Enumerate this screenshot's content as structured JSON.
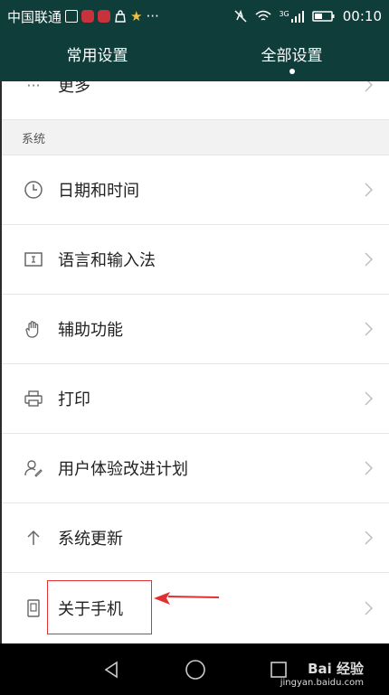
{
  "status_bar": {
    "carrier": "中国联通",
    "extra": "···",
    "network_label": "3G",
    "time": "00:10"
  },
  "tabs": [
    {
      "label": "常用设置",
      "active": false
    },
    {
      "label": "全部设置",
      "active": true
    }
  ],
  "list": {
    "top_partial": {
      "label": "更多",
      "icon": "more-icon"
    },
    "section_header": "系统",
    "items": [
      {
        "label": "日期和时间",
        "icon": "clock-icon"
      },
      {
        "label": "语言和输入法",
        "icon": "keyboard-icon"
      },
      {
        "label": "辅助功能",
        "icon": "hand-icon"
      },
      {
        "label": "打印",
        "icon": "printer-icon"
      },
      {
        "label": "用户体验改进计划",
        "icon": "user-edit-icon"
      },
      {
        "label": "系统更新",
        "icon": "arrow-up-icon"
      },
      {
        "label": "关于手机",
        "icon": "phone-icon",
        "highlighted": true
      }
    ]
  },
  "nav_bar": {
    "buttons": [
      "back-icon",
      "home-icon",
      "recents-icon"
    ]
  },
  "watermark": {
    "main": "Bai  经验",
    "sub": "jingyan.baidu.com"
  },
  "colors": {
    "header_bg": "#0e3d3a",
    "highlight": "#e03030",
    "text": "#222222"
  }
}
